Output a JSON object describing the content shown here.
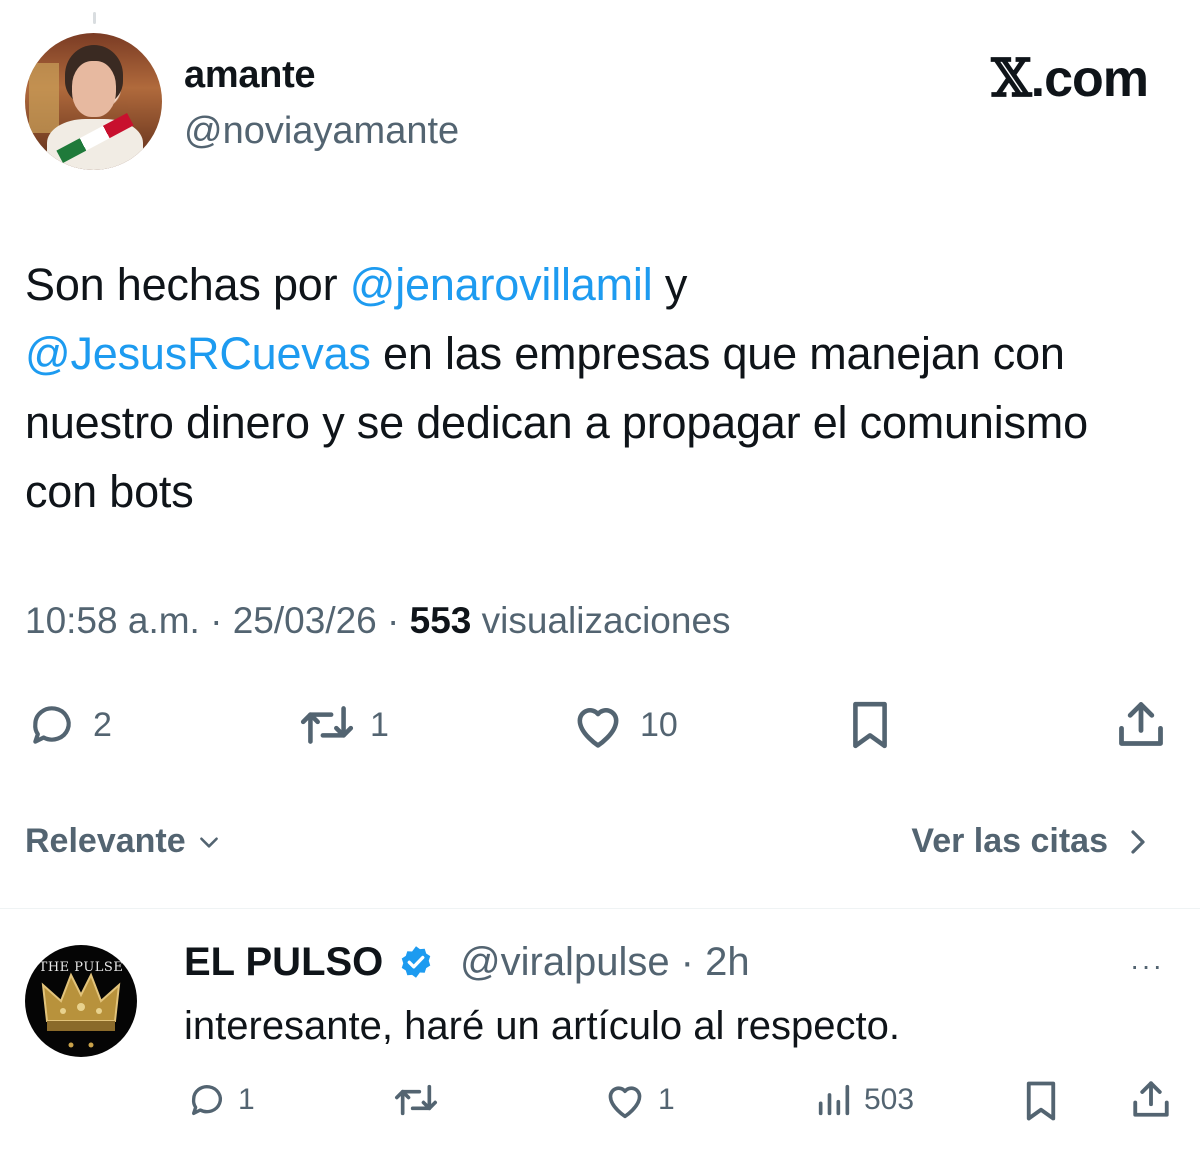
{
  "tweet": {
    "author": {
      "display_name": "amante",
      "handle": "@noviayamante"
    },
    "brand": {
      "mark": "𝕏",
      "suffix": ".com"
    },
    "text": {
      "p1": "Son hechas por ",
      "mention1": "@jenarovillamil",
      "p2": " y ",
      "mention2": "@JesusRCuevas",
      "p3": " en las empresas que manejan con nuestro dinero y se dedican a propagar el comunismo con bots"
    },
    "meta": {
      "time": "10:58 a.m.",
      "sep1": " · ",
      "date": "25/03/26",
      "sep2": " · ",
      "views_count": "553",
      "views_label": " visualizaciones"
    },
    "actions": {
      "replies": "2",
      "reposts": "1",
      "likes": "10"
    }
  },
  "filters": {
    "sort_label": "Relevante",
    "quotes_label": "Ver las citas"
  },
  "reply": {
    "avatar_text": "THE PULSE",
    "display_name": "EL PULSO",
    "handle_time": "@viralpulse · 2h",
    "text": "interesante, haré un artículo al respecto.",
    "more": "···",
    "actions": {
      "replies": "1",
      "likes": "1",
      "views": "503"
    }
  },
  "colors": {
    "text": "#0f1419",
    "secondary": "#536471",
    "link": "#1d9bf0",
    "verified": "#1d9bf0"
  }
}
